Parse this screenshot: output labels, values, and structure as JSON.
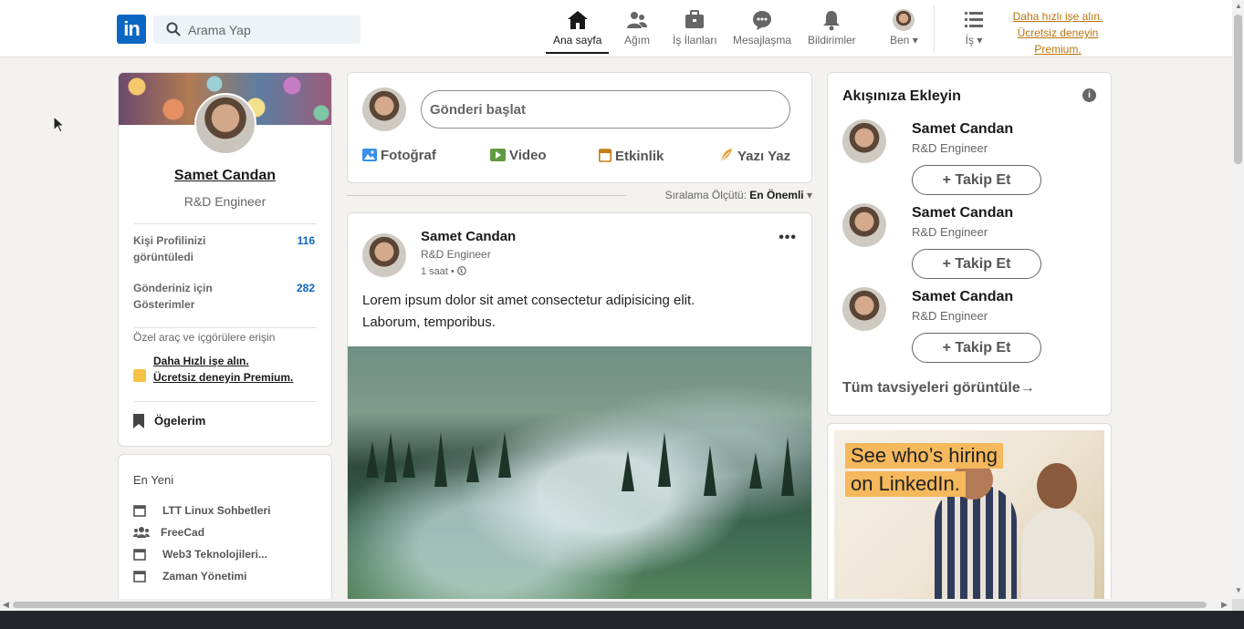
{
  "nav": {
    "logo": "in",
    "search_placeholder": "Arama Yap",
    "items": [
      {
        "label": "Ana sayfa",
        "icon": "home-icon"
      },
      {
        "label": "Ağım",
        "icon": "network-icon"
      },
      {
        "label": "İş İlanları",
        "icon": "briefcase-icon"
      },
      {
        "label": "Mesajlaşma",
        "icon": "messaging-icon"
      },
      {
        "label": "Bildirimler",
        "icon": "bell-icon"
      },
      {
        "label": "Ben",
        "icon": "avatar"
      },
      {
        "label": "İş",
        "icon": "grid-icon"
      }
    ],
    "premium_line1": "Daha hızlı işe alın.",
    "premium_line2": "Ücretsiz deneyin",
    "premium_line3": "Premium."
  },
  "profile": {
    "name": "Samet Candan",
    "title": "R&D Engineer",
    "stats": [
      {
        "label": "Kişi Profilinizi görüntüledi",
        "value": "116"
      },
      {
        "label": "Gönderiniz için Gösterimler",
        "value": "282"
      }
    ],
    "tools_text": "Özel araç ve içgörülere erişin",
    "premium_line1": "Daha Hızlı işe alın.",
    "premium_line2": "Ücretsiz deneyin Premium.",
    "saved_items": "Ögelerim"
  },
  "recent": {
    "heading": "En Yeni",
    "items": [
      {
        "label": "LTT Linux Sohbetleri",
        "icon": "calendar-icon"
      },
      {
        "label": "FreeCad",
        "icon": "group-icon"
      },
      {
        "label": "Web3 Teknolojileri...",
        "icon": "calendar-icon"
      },
      {
        "label": "Zaman Yönetimi",
        "icon": "calendar-icon"
      }
    ]
  },
  "composer": {
    "start_post": "Gönderi başlat",
    "actions": [
      {
        "label": "Fotoğraf",
        "icon": "photo-icon",
        "color": "#378fe9"
      },
      {
        "label": "Video",
        "icon": "video-icon",
        "color": "#5f9b41"
      },
      {
        "label": "Etkinlik",
        "icon": "calendar-icon",
        "color": "#c37d16"
      },
      {
        "label": "Yazı Yaz",
        "icon": "article-icon",
        "color": "#e16745"
      }
    ]
  },
  "sort": {
    "label": "Sıralama Ölçütü:",
    "value": "En Önemli"
  },
  "post": {
    "author": "Samet Candan",
    "title": "R&D Engineer",
    "time": "1 saat •",
    "more": "•••",
    "body_line1": "Lorem ipsum dolor sit amet consectetur adipisicing elit.",
    "body_line2": "Laborum, temporibus."
  },
  "feed_recs": {
    "title": "Akışınıza Ekleyin",
    "info": "i",
    "people": [
      {
        "name": "Samet Candan",
        "title": "R&D Engineer",
        "button": "Takip Et"
      },
      {
        "name": "Samet Candan",
        "title": "R&D Engineer",
        "button": "Takip Et"
      },
      {
        "name": "Samet Candan",
        "title": "R&D Engineer",
        "button": "Takip Et"
      }
    ],
    "view_all": "Tüm tavsiyeleri görüntüle"
  },
  "ad": {
    "line1": "See who’s hiring",
    "line2": "on LinkedIn."
  },
  "colors": {
    "brand": "#0a66c2",
    "premium": "#b9730f",
    "background": "#f3f2ef"
  }
}
